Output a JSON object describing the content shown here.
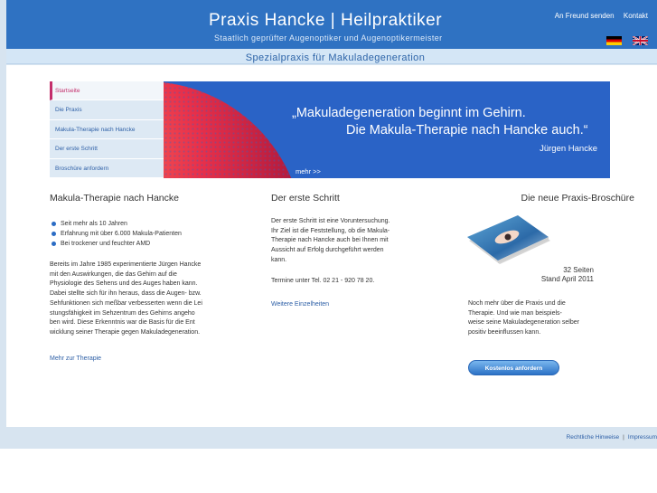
{
  "header": {
    "title": "Praxis Hancke  |  Heilpraktiker",
    "subtitle": "Staatlich geprüfter Augenoptiker und Augenoptikermeister",
    "links": {
      "recommend": "An Freund senden",
      "contact": "Kontakt"
    },
    "languages": [
      "de-flag",
      "uk-flag"
    ]
  },
  "subbar": {
    "text": "Spezialpraxis für Makuladegeneration"
  },
  "nav": {
    "items": [
      {
        "label": "Startseite",
        "active": true
      },
      {
        "label": "Die Praxis"
      },
      {
        "label": "Makula-Therapie nach Hancke"
      },
      {
        "label": "Der erste Schritt"
      },
      {
        "label": "Broschüre anfordern"
      }
    ]
  },
  "banner": {
    "quote_line1": "„Makuladegeneration beginnt im Gehirn.",
    "quote_line2": "Die Makula-Therapie nach Hancke auch.“",
    "author": "Jürgen Hancke",
    "more": "mehr >>"
  },
  "col1": {
    "title": "Makula-Therapie nach Hancke",
    "bullets": [
      "Seit mehr als 10 Jahren",
      "Erfahrung mit über 6.000 Makula-Patienten",
      "Bei trockener und feuchter AMD"
    ],
    "para": [
      "Bereits im Jahre 1985 experimentierte Jürgen Hancke",
      "mit den Auswirkungen, die das Gehirn auf die",
      "Physiologie des Sehens und des Auges haben kann.",
      "Dabei stellte sich für ihn heraus, dass die Augen- bzw.",
      "Sehfunktionen sich meßbar verbesserten wenn die Lei",
      "stungsfähigkeit im Sehzentrum des Gehirns angeho",
      "ben wird. Diese Erkenntnis war die Basis für die Ent",
      "wicklung seiner Therapie gegen Makuladegeneration."
    ],
    "link": "Mehr zur Therapie"
  },
  "col2": {
    "title": "Der erste Schritt",
    "para1": [
      "Der erste Schritt ist eine Voruntersuchung.",
      "Ihr Ziel ist die Feststellung, ob die Makula-",
      "Therapie nach Hancke auch bei Ihnen mit",
      "Aussicht auf Erfolg durchgeführt werden",
      "kann."
    ],
    "para2": "Termine unter Tel. 02 21 - 920 78 20.",
    "link": "Weitere Einzelheiten"
  },
  "col3": {
    "title": "Die neue Praxis-Broschüre",
    "caption_line1": "32 Seiten",
    "caption_line2": "Stand April 2011",
    "para": [
      "Noch mehr über die Praxis und die",
      "Therapie. Und wie man beispiels-",
      "weise seine Makuladegeneration selber",
      "positiv beeinflussen kann."
    ],
    "button": "Kostenlos anfordern"
  },
  "footer": {
    "legal": "Rechtliche Hinweise",
    "separator": "|",
    "imprint": "Impressum"
  },
  "colors": {
    "header_blue": "#2f72c2",
    "accent_pink": "#c42e6b",
    "link_blue": "#2d5fa6"
  }
}
